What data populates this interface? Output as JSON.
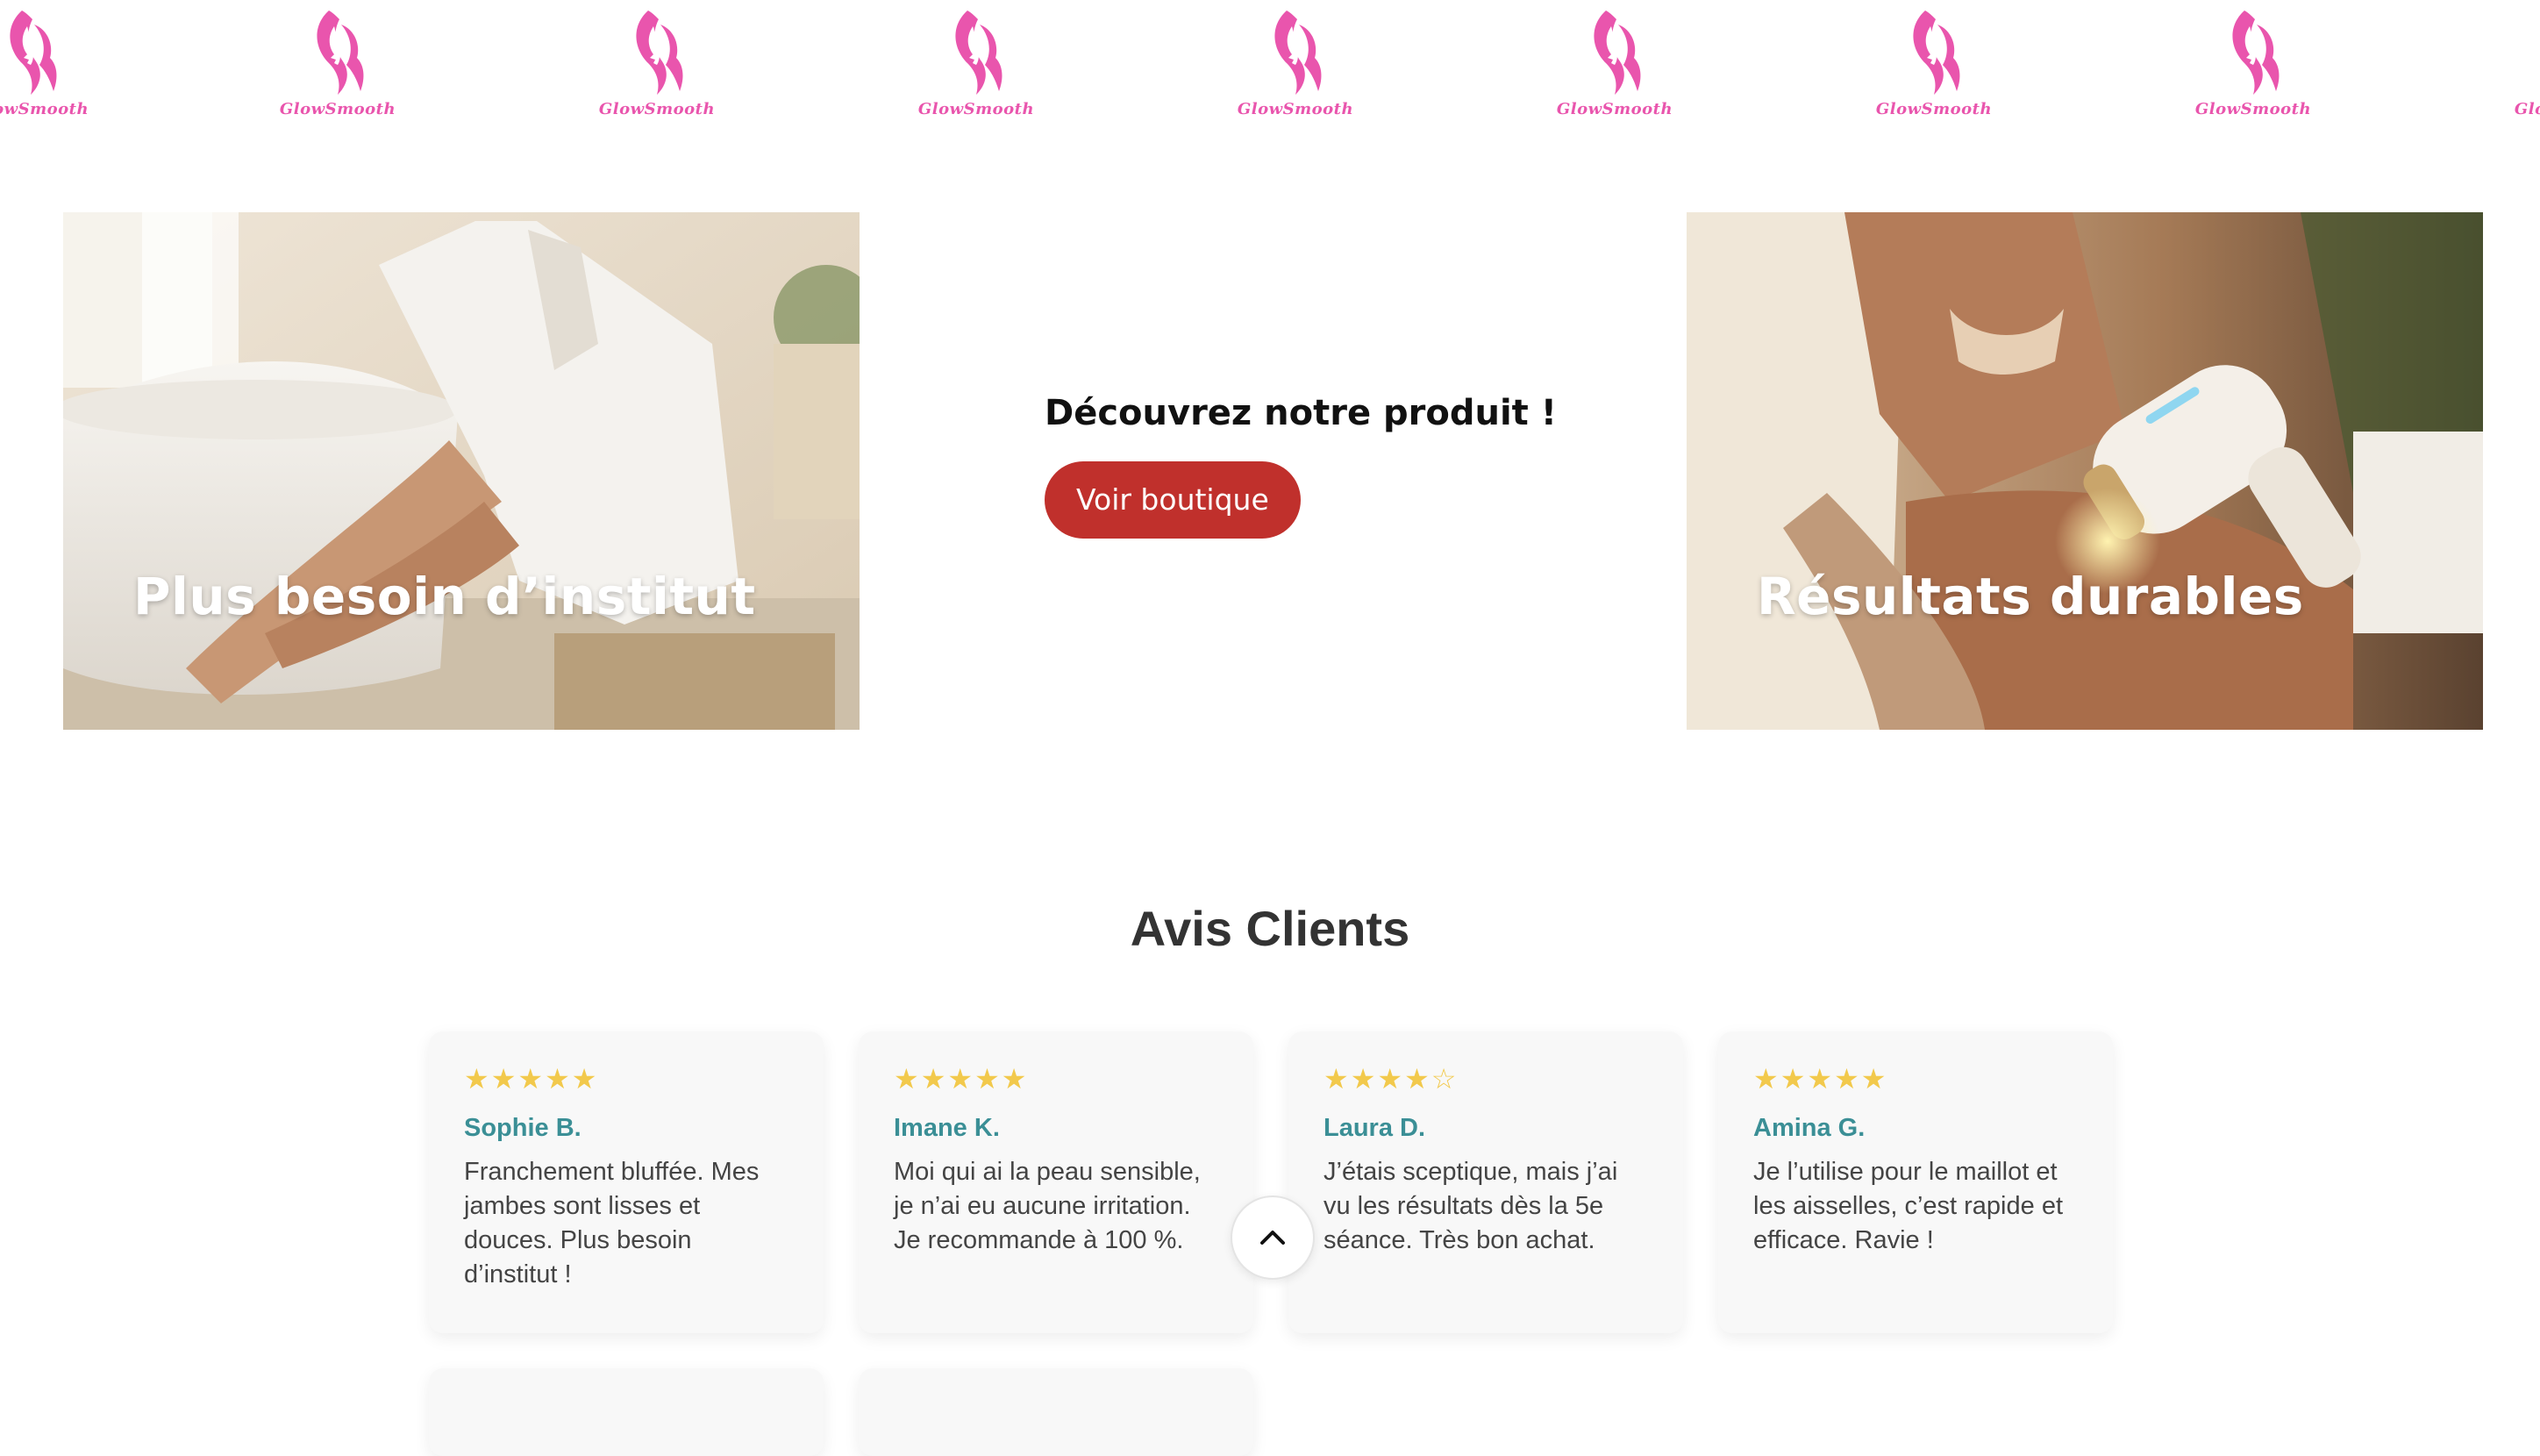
{
  "brand": {
    "name": "GlowSmooth",
    "logo_icon": "woman-profile-icon",
    "color": "#e955ad"
  },
  "features": [
    {
      "caption": "Plus besoin d’institut",
      "image": "woman-in-bathrobe-photo"
    },
    {
      "caption": "Résultats durables",
      "image": "ipl-device-on-leg-photo"
    }
  ],
  "promo": {
    "heading": "Découvrez notre produit !",
    "button_label": "Voir boutique",
    "button_color": "#c0302c"
  },
  "reviews": {
    "title": "Avis Clients",
    "items": [
      {
        "stars": "★★★★★",
        "rating": 5,
        "name": "Sophie B.",
        "text": "Franchement bluffée. Mes jambes sont lisses et douces. Plus besoin d’institut !"
      },
      {
        "stars": "★★★★★",
        "rating": 5,
        "name": "Imane K.",
        "text": "Moi qui ai la peau sensible, je n’ai eu aucune irritation. Je recommande à 100 %."
      },
      {
        "stars": "★★★★☆",
        "rating": 4,
        "name": "Laura D.",
        "text": "J’étais sceptique, mais j’ai vu les résultats dès la 5e séance. Très bon achat."
      },
      {
        "stars": "★★★★★",
        "rating": 5,
        "name": "Amina G.",
        "text": "Je l’utilise pour le maillot et les aisselles, c’est rapide et efficace. Ravie !"
      }
    ],
    "star_color": "#f2c94c",
    "name_color": "#3b8f96"
  },
  "scroll_top": {
    "icon": "chevron-up-icon"
  }
}
